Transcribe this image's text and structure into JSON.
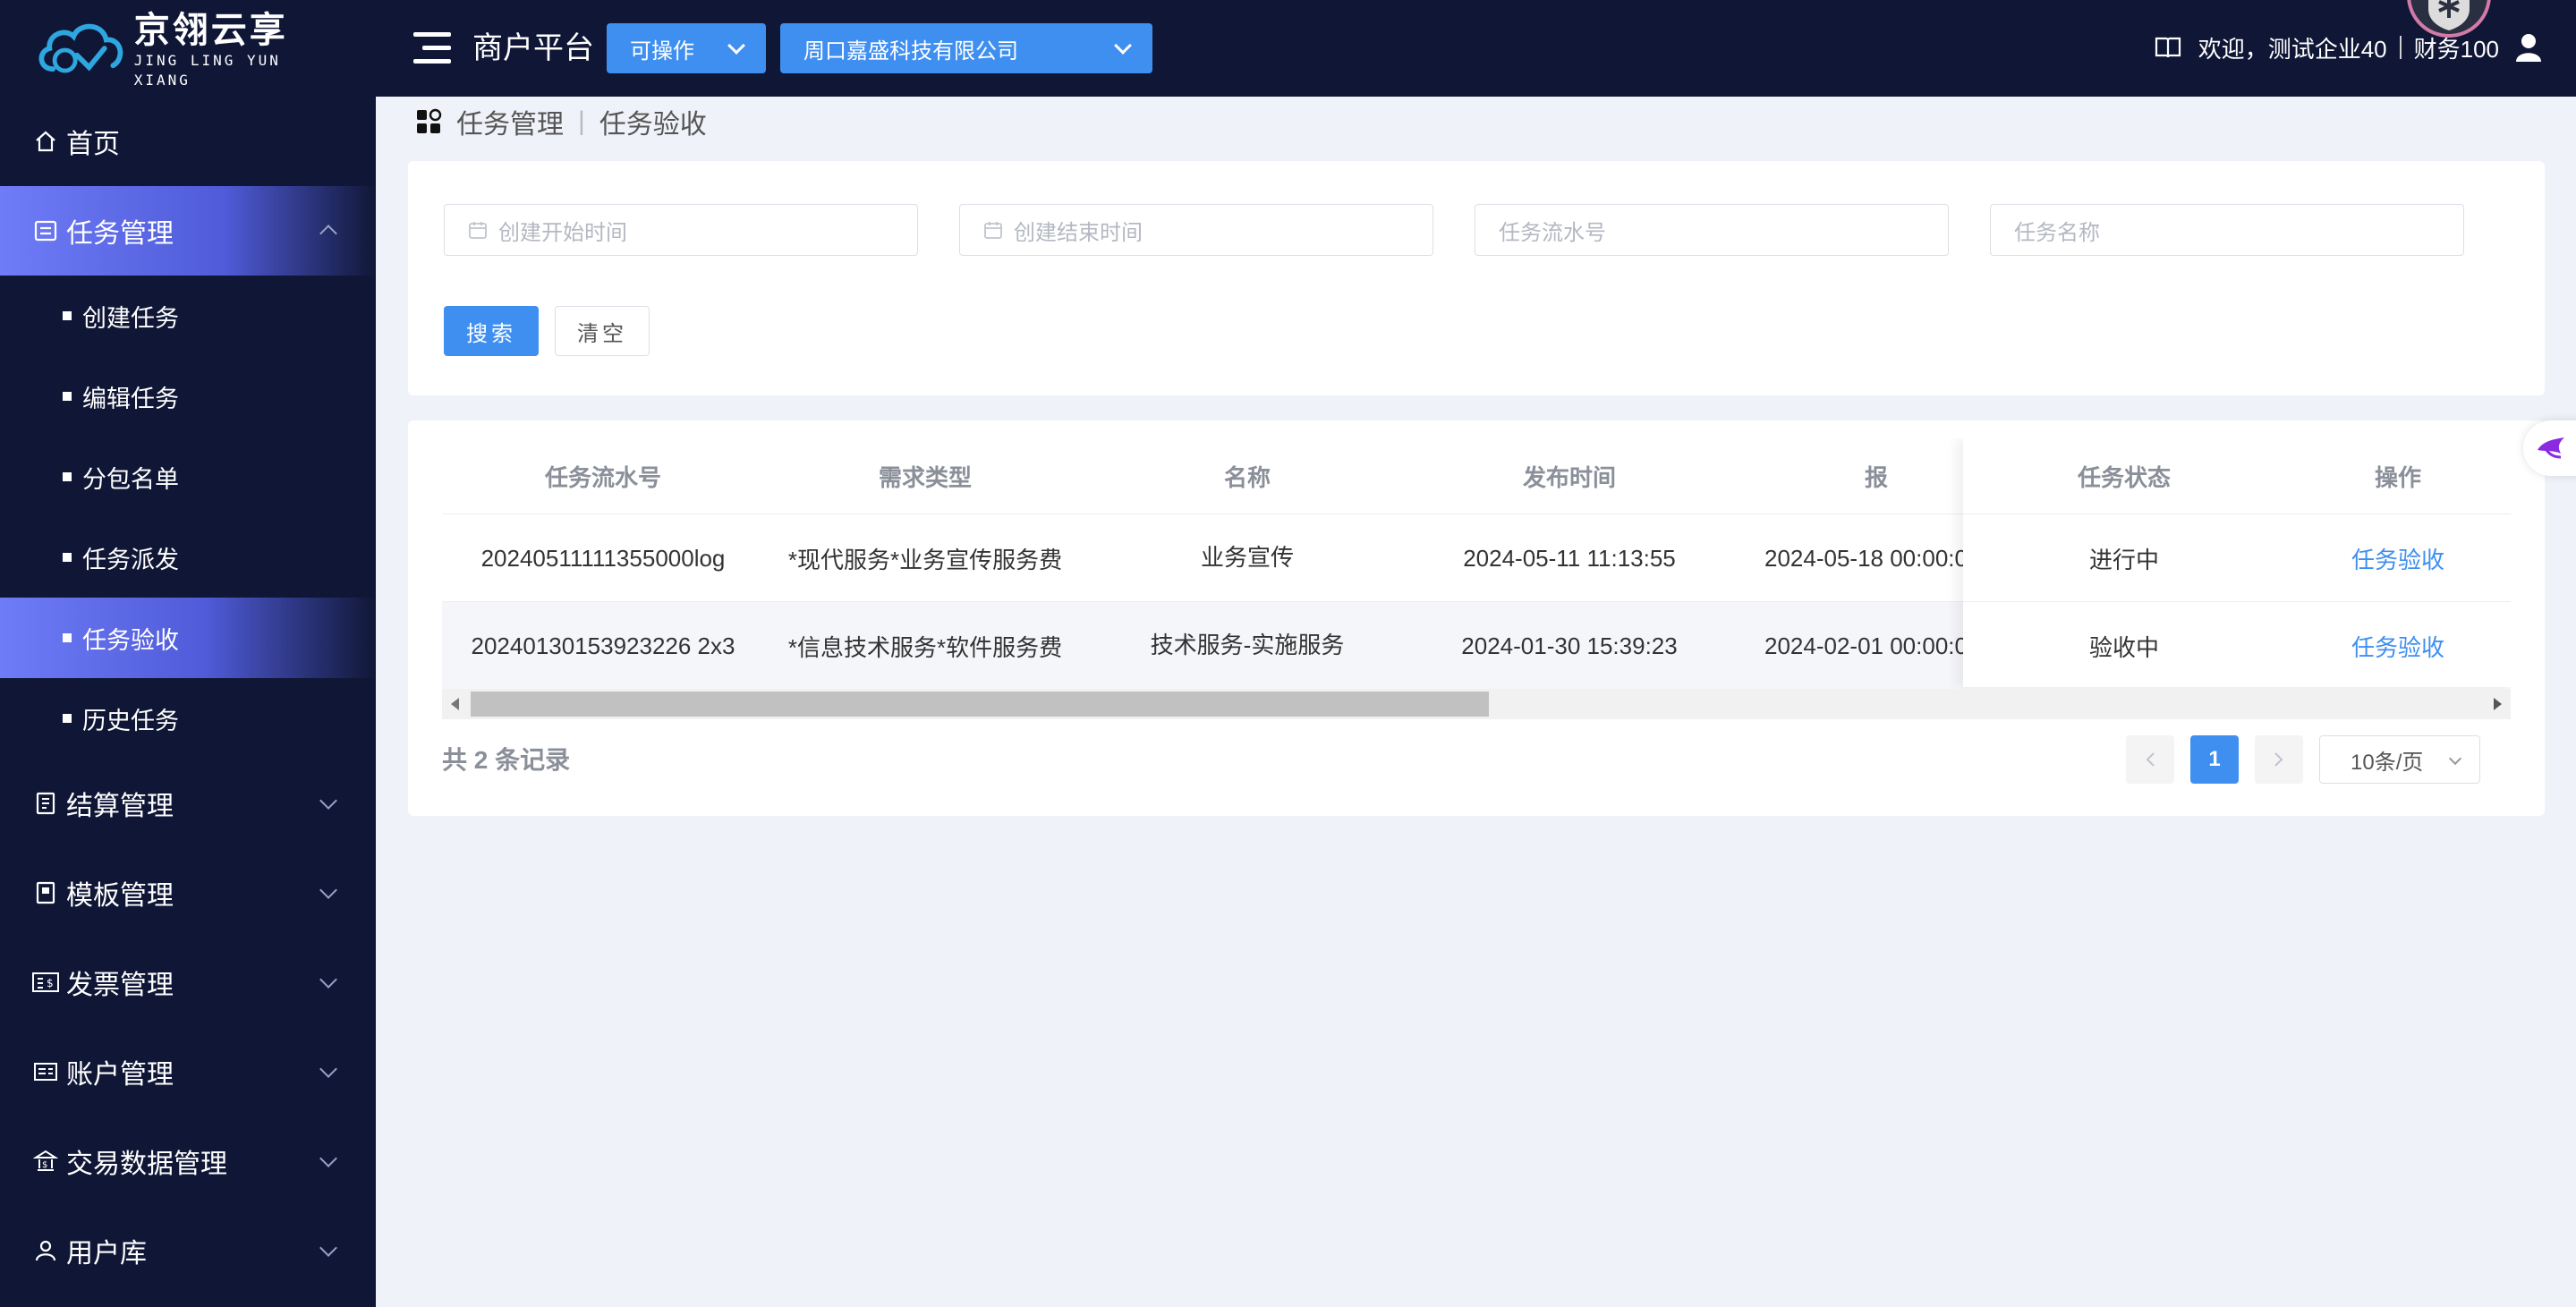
{
  "logo": {
    "cn": "京翎云享",
    "en": "JING LING YUN XIANG"
  },
  "menu": [
    {
      "label": "首页",
      "icon": "home-icon"
    },
    {
      "label": "任务管理",
      "icon": "task-icon",
      "active": true
    },
    {
      "label": "结算管理",
      "icon": "settlement-icon"
    },
    {
      "label": "模板管理",
      "icon": "template-icon"
    },
    {
      "label": "发票管理",
      "icon": "invoice-icon"
    },
    {
      "label": "账户管理",
      "icon": "account-icon"
    },
    {
      "label": "交易数据管理",
      "icon": "bank-icon"
    },
    {
      "label": "用户库",
      "icon": "user-icon"
    }
  ],
  "submenu": [
    "创建任务",
    "编辑任务",
    "分包名单",
    "任务派发",
    "任务验收",
    "历史任务"
  ],
  "topbar": {
    "title": "商户平台",
    "status_select": "可操作",
    "company_select": "周口嘉盛科技有限公司",
    "welcome": "欢迎，测试企业40",
    "user": "财务100"
  },
  "breadcrumb": [
    "任务管理",
    "任务验收"
  ],
  "search": {
    "start_placeholder": "创建开始时间",
    "end_placeholder": "创建结束时间",
    "serial_placeholder": "任务流水号",
    "name_placeholder": "任务名称",
    "search_label": "搜索",
    "clear_label": "清空"
  },
  "table": {
    "columns": [
      "任务流水号",
      "需求类型",
      "名称",
      "发布时间",
      "报",
      "任务状态",
      "操作"
    ],
    "rows": [
      {
        "serial": "20240511111355000log",
        "type": "*现代服务*业务宣传服务费",
        "name": "业务宣传",
        "publish": "2024-05-11 11:13:55",
        "deadline": "2024-05-18 00:00:0",
        "status": "进行中",
        "action": "任务验收"
      },
      {
        "serial": "20240130153923226 2x3",
        "type": "*信息技术服务*软件服务费",
        "name": "技术服务-实施服务",
        "publish": "2024-01-30 15:39:23",
        "deadline": "2024-02-01 00:00:0",
        "status": "验收中",
        "action": "任务验收"
      }
    ]
  },
  "pagination": {
    "total": "共 2 条记录",
    "current": "1",
    "page_size": "10条/页"
  },
  "colors": {
    "sidebar": "#101736",
    "accent": "#3f8ff0",
    "active_gradient": "#6f7cf7"
  }
}
